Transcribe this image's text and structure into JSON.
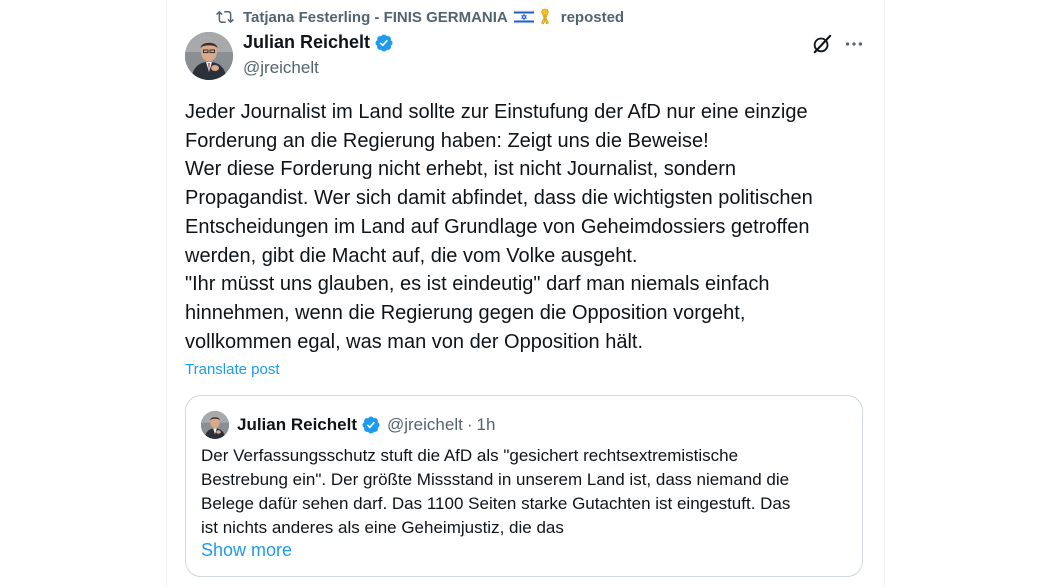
{
  "repost": {
    "reposter": "Tatjana Festerling - FINIS GERMANIA",
    "label": "reposted"
  },
  "post": {
    "author_name": "Julian Reichelt",
    "author_handle": "@jreichelt",
    "lines": [
      "Jeder Journalist im Land sollte zur Einstufung der AfD nur eine einzige",
      "Forderung an die Regierung haben: Zeigt uns die Beweise!",
      "Wer diese Forderung nicht erhebt, ist nicht Journalist, sondern",
      "Propagandist. Wer sich damit abfindet, dass die wichtigsten politischen",
      "Entscheidungen im Land auf Grundlage von Geheimdossiers getroffen",
      "werden, gibt die Macht auf, die vom Volke ausgeht.",
      "\"Ihr müsst uns glauben, es ist eindeutig\" darf man niemals einfach",
      "hinnehmen, wenn die Regierung gegen die Opposition vorgeht,",
      "vollkommen egal, was man von der Opposition hält."
    ],
    "translate_label": "Translate post"
  },
  "quote": {
    "author_name": "Julian Reichelt",
    "author_handle": "@jreichelt",
    "separator": "·",
    "time": "1h",
    "lines": [
      "Der Verfassungsschutz stuft die AfD als \"gesichert rechtsextremistische",
      "Bestrebung ein\". Der größte Missstand in unserem Land ist, dass niemand die",
      "Belege dafür sehen darf. Das 1100 Seiten starke Gutachten ist eingestuft. Das",
      "ist nichts anderes als eine Geheimjustiz, die das"
    ],
    "show_more_label": "Show more"
  },
  "icons": {
    "repost": "repost-icon",
    "flag": "israel-flag-icon",
    "ribbon": "yellow-ribbon-icon",
    "verified": "verified-badge-icon",
    "grok": "grok-icon",
    "more": "more-options-icon"
  },
  "colors": {
    "accent": "#1d9bf0",
    "secondary_text": "#536471",
    "text": "#0f1419",
    "border": "#cfd9de"
  }
}
